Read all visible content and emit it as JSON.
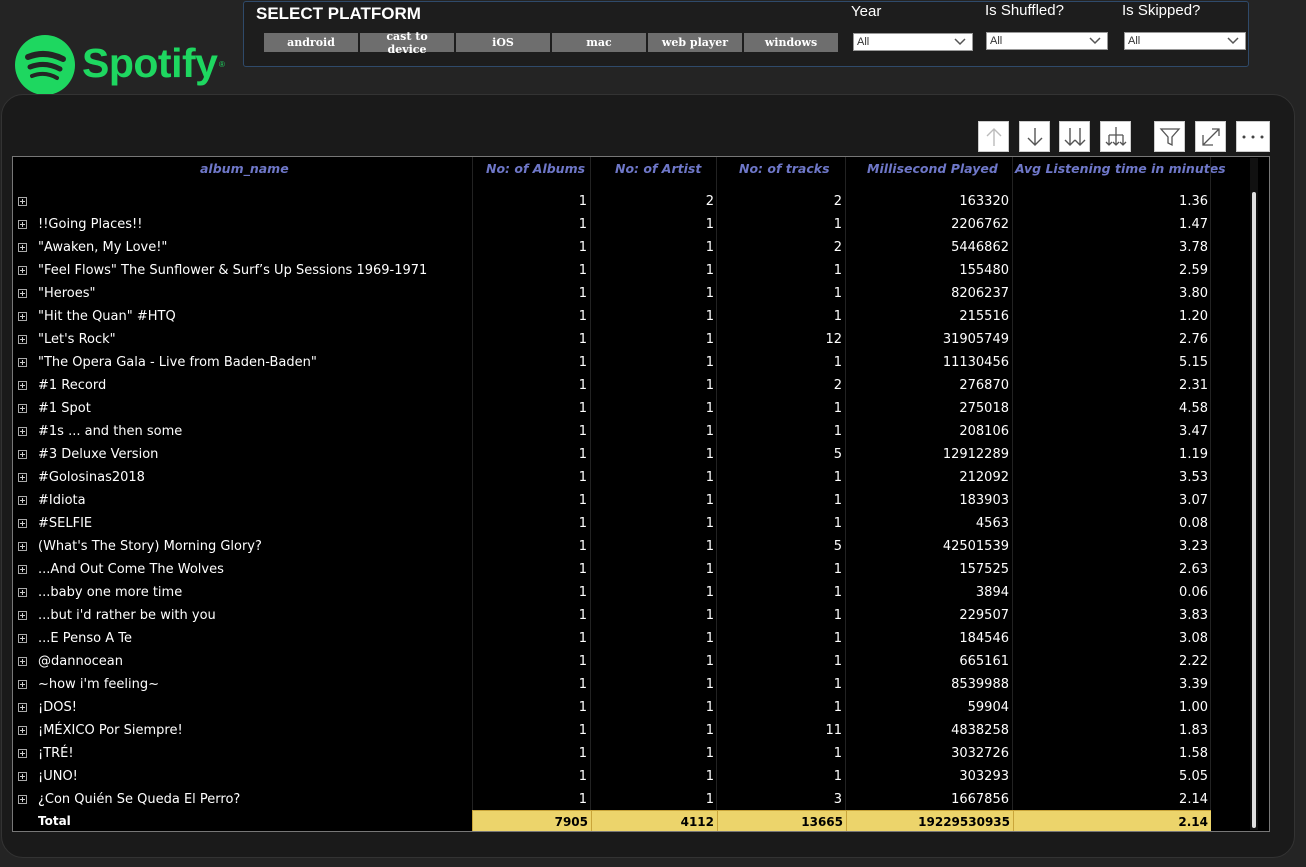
{
  "brand": {
    "name": "Spotify",
    "reg": "®",
    "color": "#1ed760"
  },
  "platform": {
    "title": "SELECT PLATFORM",
    "buttons": [
      "android",
      "cast to device",
      "iOS",
      "mac",
      "web player",
      "windows"
    ]
  },
  "slicers": {
    "year": {
      "label": "Year",
      "value": "All"
    },
    "shuffled": {
      "label": "Is Shuffled?",
      "value": "All"
    },
    "skipped": {
      "label": "Is Skipped?",
      "value": "All"
    }
  },
  "toolbar": [
    "arrow-up-icon",
    "arrow-down-icon",
    "double-arrow-down-icon",
    "expand-hierarchy-icon",
    "filter-icon",
    "focus-mode-icon",
    "more-options-icon"
  ],
  "table": {
    "headers": {
      "album": "album_name",
      "albums": "No: of Albums",
      "artist": "No: of Artist",
      "tracks": "No: of tracks",
      "ms": "Millisecond Played",
      "avg": "Avg Listening time in minutes"
    },
    "rows": [
      {
        "album": "",
        "albums": "1",
        "artist": "2",
        "tracks": "2",
        "ms": "163320",
        "avg": "1.36"
      },
      {
        "album": "!!Going Places!!",
        "albums": "1",
        "artist": "1",
        "tracks": "1",
        "ms": "2206762",
        "avg": "1.47"
      },
      {
        "album": "\"Awaken, My Love!\"",
        "albums": "1",
        "artist": "1",
        "tracks": "2",
        "ms": "5446862",
        "avg": "3.78"
      },
      {
        "album": "\"Feel Flows\" The Sunflower & Surf’s Up Sessions 1969-1971",
        "albums": "1",
        "artist": "1",
        "tracks": "1",
        "ms": "155480",
        "avg": "2.59"
      },
      {
        "album": "\"Heroes\"",
        "albums": "1",
        "artist": "1",
        "tracks": "1",
        "ms": "8206237",
        "avg": "3.80"
      },
      {
        "album": "\"Hit the Quan\" #HTQ",
        "albums": "1",
        "artist": "1",
        "tracks": "1",
        "ms": "215516",
        "avg": "1.20"
      },
      {
        "album": "\"Let's Rock\"",
        "albums": "1",
        "artist": "1",
        "tracks": "12",
        "ms": "31905749",
        "avg": "2.76"
      },
      {
        "album": "\"The Opera Gala - Live from Baden-Baden\"",
        "albums": "1",
        "artist": "1",
        "tracks": "1",
        "ms": "11130456",
        "avg": "5.15"
      },
      {
        "album": "#1 Record",
        "albums": "1",
        "artist": "1",
        "tracks": "2",
        "ms": "276870",
        "avg": "2.31"
      },
      {
        "album": "#1 Spot",
        "albums": "1",
        "artist": "1",
        "tracks": "1",
        "ms": "275018",
        "avg": "4.58"
      },
      {
        "album": "#1s ... and then some",
        "albums": "1",
        "artist": "1",
        "tracks": "1",
        "ms": "208106",
        "avg": "3.47"
      },
      {
        "album": "#3 Deluxe Version",
        "albums": "1",
        "artist": "1",
        "tracks": "5",
        "ms": "12912289",
        "avg": "1.19"
      },
      {
        "album": "#Golosinas2018",
        "albums": "1",
        "artist": "1",
        "tracks": "1",
        "ms": "212092",
        "avg": "3.53"
      },
      {
        "album": "#Idiota",
        "albums": "1",
        "artist": "1",
        "tracks": "1",
        "ms": "183903",
        "avg": "3.07"
      },
      {
        "album": "#SELFIE",
        "albums": "1",
        "artist": "1",
        "tracks": "1",
        "ms": "4563",
        "avg": "0.08"
      },
      {
        "album": "(What's The Story) Morning Glory?",
        "albums": "1",
        "artist": "1",
        "tracks": "5",
        "ms": "42501539",
        "avg": "3.23"
      },
      {
        "album": "...And Out Come The Wolves",
        "albums": "1",
        "artist": "1",
        "tracks": "1",
        "ms": "157525",
        "avg": "2.63"
      },
      {
        "album": "...baby one more time",
        "albums": "1",
        "artist": "1",
        "tracks": "1",
        "ms": "3894",
        "avg": "0.06"
      },
      {
        "album": "...but i'd rather be with you",
        "albums": "1",
        "artist": "1",
        "tracks": "1",
        "ms": "229507",
        "avg": "3.83"
      },
      {
        "album": "...E Penso A Te",
        "albums": "1",
        "artist": "1",
        "tracks": "1",
        "ms": "184546",
        "avg": "3.08"
      },
      {
        "album": "@dannocean",
        "albums": "1",
        "artist": "1",
        "tracks": "1",
        "ms": "665161",
        "avg": "2.22"
      },
      {
        "album": "~how i'm feeling~",
        "albums": "1",
        "artist": "1",
        "tracks": "1",
        "ms": "8539988",
        "avg": "3.39"
      },
      {
        "album": "¡DOS!",
        "albums": "1",
        "artist": "1",
        "tracks": "1",
        "ms": "59904",
        "avg": "1.00"
      },
      {
        "album": "¡MÉXICO Por Siempre!",
        "albums": "1",
        "artist": "1",
        "tracks": "11",
        "ms": "4838258",
        "avg": "1.83"
      },
      {
        "album": "¡TRÉ!",
        "albums": "1",
        "artist": "1",
        "tracks": "1",
        "ms": "3032726",
        "avg": "1.58"
      },
      {
        "album": "¡UNO!",
        "albums": "1",
        "artist": "1",
        "tracks": "1",
        "ms": "303293",
        "avg": "5.05"
      },
      {
        "album": "¿Con Quién Se Queda El Perro?",
        "albums": "1",
        "artist": "1",
        "tracks": "3",
        "ms": "1667856",
        "avg": "2.14"
      }
    ],
    "total": {
      "label": "Total",
      "albums": "7905",
      "artist": "4112",
      "tracks": "13665",
      "ms": "19229530935",
      "avg": "2.14"
    },
    "total_color": "#ecd46b",
    "header_color": "#6e77c8"
  }
}
